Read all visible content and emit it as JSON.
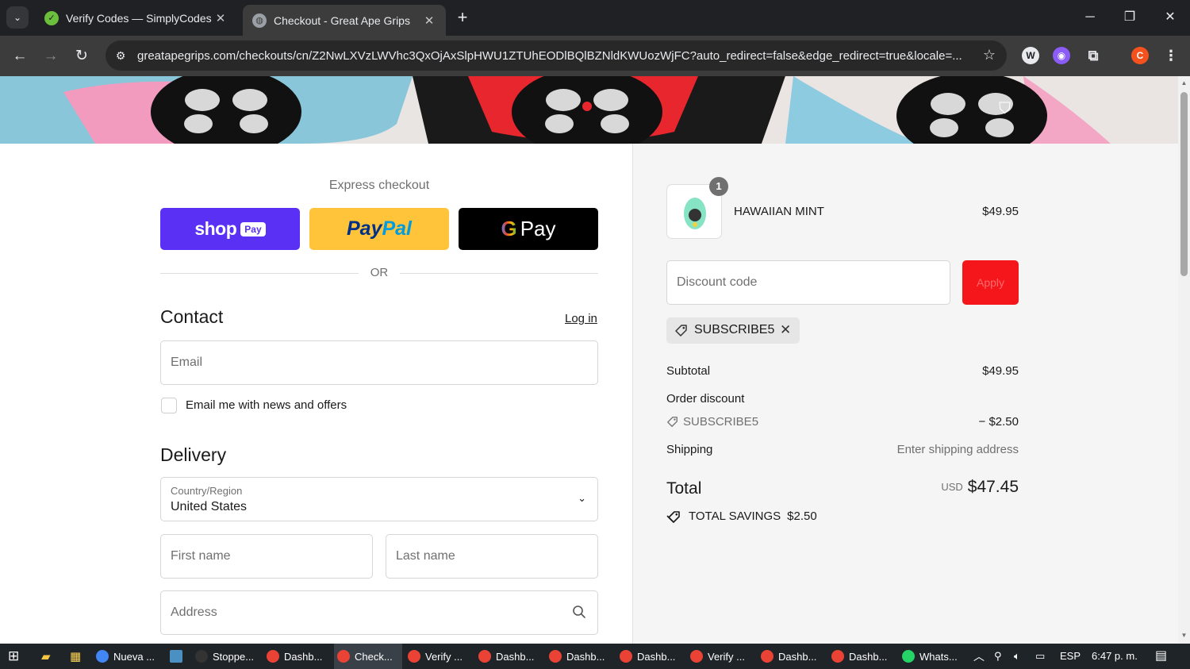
{
  "browser": {
    "tabs": [
      {
        "title": "Verify Codes — SimplyCodes",
        "close": "✕"
      },
      {
        "title": "Checkout - Great Ape Grips",
        "close": "✕"
      }
    ],
    "tab_search_icon": "⌄",
    "new_tab": "+",
    "window": {
      "minimize": "─",
      "restore": "❐",
      "close": "✕"
    },
    "nav": {
      "back": "←",
      "forward": "→",
      "reload": "↻"
    },
    "url": "greatapegrips.com/checkouts/cn/Z2NwLXVzLWVhc3QxOjAxSlpHWU1ZTUhEODlBQlBZNldKWUozWjFC?auto_redirect=false&edge_redirect=true&locale=...",
    "site_info_icon": "⚙",
    "star_icon": "☆",
    "profile_initial": "C"
  },
  "checkout": {
    "express_label": "Express checkout",
    "shop_pay": {
      "shop": "shop",
      "pay": "Pay"
    },
    "paypal": {
      "pay": "Pay",
      "pal": "Pal"
    },
    "gpay": {
      "g": "G",
      "pay": "Pay"
    },
    "or": "OR",
    "contact": {
      "title": "Contact",
      "login": "Log in",
      "email_placeholder": "Email",
      "newsletter": "Email me with news and offers"
    },
    "delivery": {
      "title": "Delivery",
      "country_label": "Country/Region",
      "country_value": "United States",
      "first_name": "First name",
      "last_name": "Last name",
      "address": "Address"
    }
  },
  "summary": {
    "item": {
      "name": "HAWAIIAN MINT",
      "price": "$49.95",
      "qty": "1"
    },
    "discount_placeholder": "Discount code",
    "apply": "Apply",
    "applied_code": "SUBSCRIBE5",
    "subtotal_label": "Subtotal",
    "subtotal": "$49.95",
    "order_discount_label": "Order discount",
    "discount_code": "SUBSCRIBE5",
    "discount_amount": "− $2.50",
    "shipping_label": "Shipping",
    "shipping_value": "Enter shipping address",
    "total_label": "Total",
    "currency": "USD",
    "total": "$47.45",
    "savings_label": "TOTAL SAVINGS",
    "savings": "$2.50"
  },
  "taskbar": {
    "items": [
      {
        "label": "Nueva ...",
        "color": "#4285f4"
      },
      {
        "label": "Stoppe...",
        "color": "#333333"
      },
      {
        "label": "Dashb...",
        "color": "#ea4335"
      },
      {
        "label": "Check...",
        "color": "#ea4335"
      },
      {
        "label": "Verify ...",
        "color": "#ea4335"
      },
      {
        "label": "Dashb...",
        "color": "#ea4335"
      },
      {
        "label": "Dashb...",
        "color": "#ea4335"
      },
      {
        "label": "Dashb...",
        "color": "#ea4335"
      },
      {
        "label": "Verify ...",
        "color": "#ea4335"
      },
      {
        "label": "Dashb...",
        "color": "#ea4335"
      },
      {
        "label": "Dashb...",
        "color": "#ea4335"
      },
      {
        "label": "Whats...",
        "color": "#25d366"
      }
    ],
    "lang": "ESP",
    "time": "6:47 p. m."
  },
  "colors": {
    "accent": "#5a31f4",
    "apply": "#f5161b",
    "paypal": "#ffc439"
  }
}
